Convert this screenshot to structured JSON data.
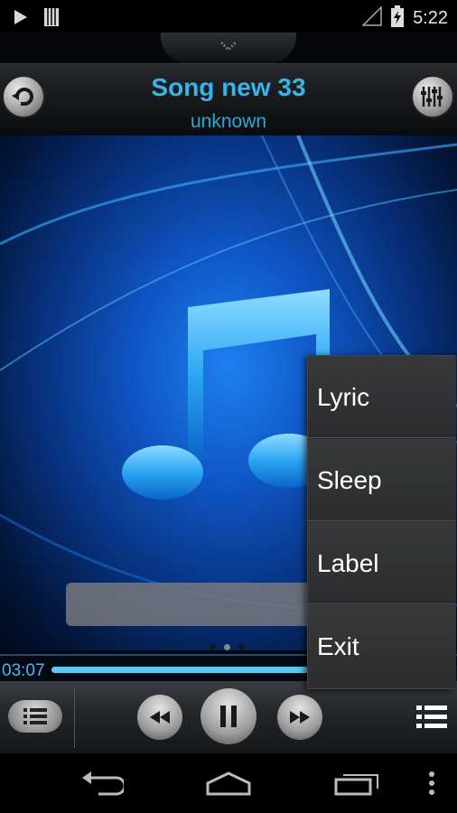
{
  "status_bar": {
    "time": "5:22"
  },
  "header": {
    "title": "Song new 33",
    "artist": "unknown"
  },
  "progress": {
    "elapsed": "03:07",
    "fraction": 0.66
  },
  "popup_menu": {
    "items": [
      {
        "label": "Lyric"
      },
      {
        "label": "Sleep"
      },
      {
        "label": "Label"
      },
      {
        "label": "Exit"
      }
    ]
  },
  "colors": {
    "accent": "#35b5ea",
    "menu_bg": "#2e2f30"
  },
  "icons": [
    "play-icon",
    "sd-card-icon",
    "signal-icon",
    "battery-icon",
    "repeat-icon",
    "equalizer-icon",
    "music-note-icon",
    "playlist-icon",
    "rewind-icon",
    "pause-icon",
    "forward-icon",
    "menu-list-icon",
    "back-icon",
    "home-icon",
    "recents-icon",
    "overflow-icon"
  ]
}
